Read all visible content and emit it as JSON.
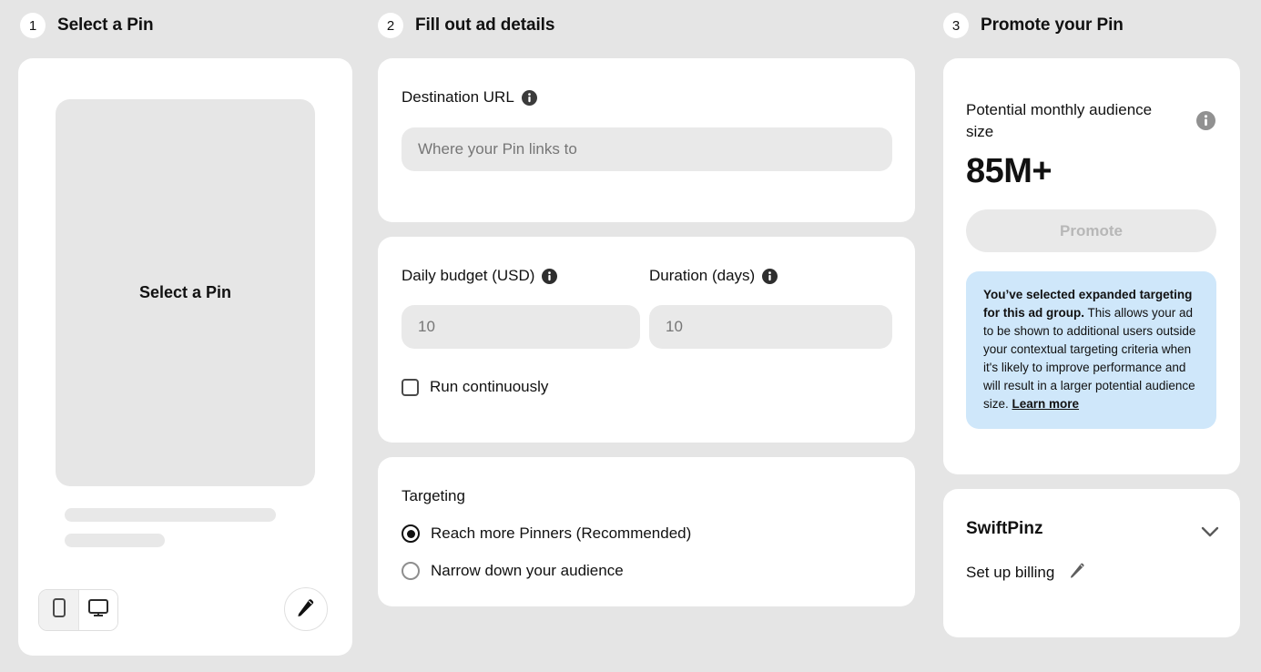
{
  "steps": [
    {
      "number": "1",
      "label": "Select a Pin"
    },
    {
      "number": "2",
      "label": "Fill out ad details"
    },
    {
      "number": "3",
      "label": "Promote your Pin"
    }
  ],
  "pin_preview": {
    "placeholder_text": "Select a Pin",
    "device_toggle": {
      "mobile_icon": "mobile-phone-icon",
      "desktop_icon": "desktop-monitor-icon",
      "selected": "mobile"
    },
    "edit_icon": "pencil-edit-icon"
  },
  "destination": {
    "label": "Destination URL",
    "info_icon": "info-circle-icon",
    "input_value": "",
    "input_placeholder": "Where your Pin links to"
  },
  "budget": {
    "daily_budget_label": "Daily budget (USD)",
    "daily_budget_info_icon": "info-circle-icon",
    "daily_budget_value": "",
    "daily_budget_placeholder": "10",
    "duration_label": "Duration (days)",
    "duration_info_icon": "info-circle-icon",
    "duration_value": "",
    "duration_placeholder": "10",
    "run_continuously_label": "Run continuously",
    "run_continuously_checked": false
  },
  "targeting": {
    "title": "Targeting",
    "options": [
      {
        "label": "Reach more Pinners (Recommended)",
        "selected": true
      },
      {
        "label": "Narrow down your audience",
        "selected": false
      }
    ]
  },
  "audience": {
    "label": "Potential monthly audience size",
    "info_icon": "info-circle-icon",
    "value": "85M+",
    "promote_button": "Promote",
    "promote_disabled": true,
    "notice": {
      "bold_lead": "You’ve selected expanded targeting for this ad group.",
      "body": " This allows your ad to be shown to additional users outside your contextual targeting criteria when it's likely to improve performance and will result in a larger potential audience size. ",
      "link": "Learn more",
      "background_color": "#cfe7fa"
    }
  },
  "account": {
    "name": "SwiftPinz",
    "chevron_icon": "chevron-down-icon",
    "billing_text": "Set up billing",
    "billing_edit_icon": "pencil-edit-icon"
  },
  "colors": {
    "page_background": "#e5e5e5",
    "card_background": "#ffffff",
    "input_background": "#e9e9e9",
    "notice_background": "#cfe7fa",
    "text_primary": "#111111",
    "text_muted": "#767676"
  }
}
